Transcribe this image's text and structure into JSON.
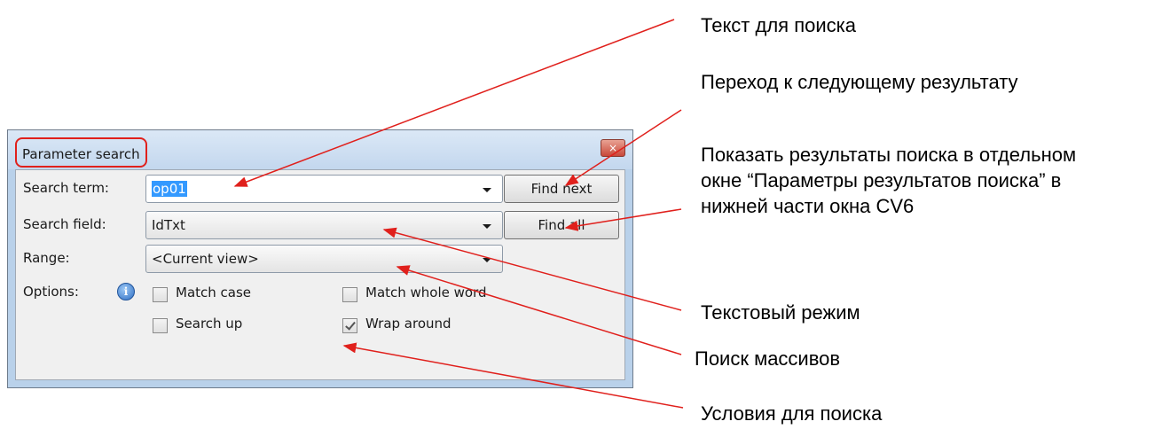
{
  "dialog": {
    "title": "Parameter search",
    "close_glyph": "×",
    "search_term_label": "Search term:",
    "search_term_value": "op01",
    "search_field_label": "Search field:",
    "search_field_value": "IdTxt",
    "range_label": "Range:",
    "range_value": "<Current view>",
    "options_label": "Options:",
    "info_glyph": "i",
    "find_next_label": "Find next",
    "find_all_label": "Find all",
    "options": {
      "match_case": {
        "label": "Match case",
        "checked": false
      },
      "match_whole_word": {
        "label": "Match whole word",
        "checked": false
      },
      "search_up": {
        "label": "Search up",
        "checked": false
      },
      "wrap_around": {
        "label": "Wrap around",
        "checked": true
      }
    }
  },
  "annotations": {
    "search_text": "Текст для поиска",
    "next_result": "Переход к следующему результату",
    "show_results": "Показать результаты поиска в отдельном окне “Параметры результатов поиска” в нижней части окна CV6",
    "text_mode": "Текстовый режим",
    "array_search": "Поиск массивов",
    "search_conditions": "Условия для поиска"
  },
  "colors": {
    "accent_red": "#e0201c",
    "selection_blue": "#3399ff",
    "frame_blue": "#b9d1ea"
  }
}
